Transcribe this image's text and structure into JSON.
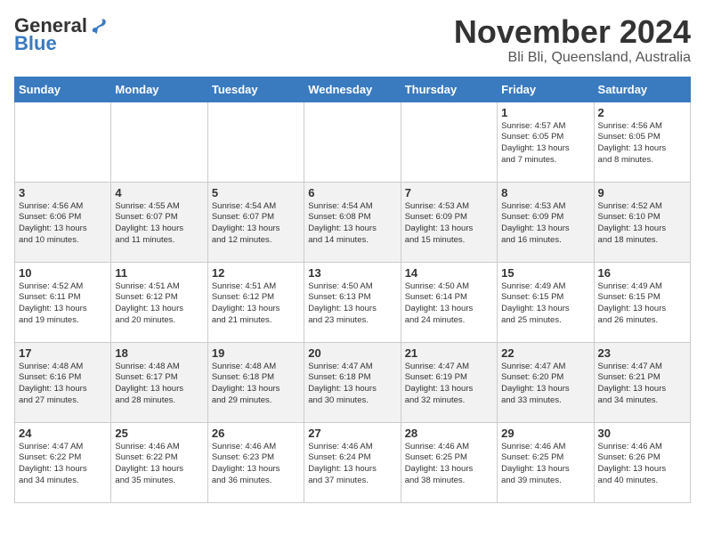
{
  "header": {
    "logo_general": "General",
    "logo_blue": "Blue",
    "month_title": "November 2024",
    "location": "Bli Bli, Queensland, Australia"
  },
  "days_of_week": [
    "Sunday",
    "Monday",
    "Tuesday",
    "Wednesday",
    "Thursday",
    "Friday",
    "Saturday"
  ],
  "weeks": [
    [
      {
        "day": "",
        "info": ""
      },
      {
        "day": "",
        "info": ""
      },
      {
        "day": "",
        "info": ""
      },
      {
        "day": "",
        "info": ""
      },
      {
        "day": "",
        "info": ""
      },
      {
        "day": "1",
        "info": "Sunrise: 4:57 AM\nSunset: 6:05 PM\nDaylight: 13 hours\nand 7 minutes."
      },
      {
        "day": "2",
        "info": "Sunrise: 4:56 AM\nSunset: 6:05 PM\nDaylight: 13 hours\nand 8 minutes."
      }
    ],
    [
      {
        "day": "3",
        "info": "Sunrise: 4:56 AM\nSunset: 6:06 PM\nDaylight: 13 hours\nand 10 minutes."
      },
      {
        "day": "4",
        "info": "Sunrise: 4:55 AM\nSunset: 6:07 PM\nDaylight: 13 hours\nand 11 minutes."
      },
      {
        "day": "5",
        "info": "Sunrise: 4:54 AM\nSunset: 6:07 PM\nDaylight: 13 hours\nand 12 minutes."
      },
      {
        "day": "6",
        "info": "Sunrise: 4:54 AM\nSunset: 6:08 PM\nDaylight: 13 hours\nand 14 minutes."
      },
      {
        "day": "7",
        "info": "Sunrise: 4:53 AM\nSunset: 6:09 PM\nDaylight: 13 hours\nand 15 minutes."
      },
      {
        "day": "8",
        "info": "Sunrise: 4:53 AM\nSunset: 6:09 PM\nDaylight: 13 hours\nand 16 minutes."
      },
      {
        "day": "9",
        "info": "Sunrise: 4:52 AM\nSunset: 6:10 PM\nDaylight: 13 hours\nand 18 minutes."
      }
    ],
    [
      {
        "day": "10",
        "info": "Sunrise: 4:52 AM\nSunset: 6:11 PM\nDaylight: 13 hours\nand 19 minutes."
      },
      {
        "day": "11",
        "info": "Sunrise: 4:51 AM\nSunset: 6:12 PM\nDaylight: 13 hours\nand 20 minutes."
      },
      {
        "day": "12",
        "info": "Sunrise: 4:51 AM\nSunset: 6:12 PM\nDaylight: 13 hours\nand 21 minutes."
      },
      {
        "day": "13",
        "info": "Sunrise: 4:50 AM\nSunset: 6:13 PM\nDaylight: 13 hours\nand 23 minutes."
      },
      {
        "day": "14",
        "info": "Sunrise: 4:50 AM\nSunset: 6:14 PM\nDaylight: 13 hours\nand 24 minutes."
      },
      {
        "day": "15",
        "info": "Sunrise: 4:49 AM\nSunset: 6:15 PM\nDaylight: 13 hours\nand 25 minutes."
      },
      {
        "day": "16",
        "info": "Sunrise: 4:49 AM\nSunset: 6:15 PM\nDaylight: 13 hours\nand 26 minutes."
      }
    ],
    [
      {
        "day": "17",
        "info": "Sunrise: 4:48 AM\nSunset: 6:16 PM\nDaylight: 13 hours\nand 27 minutes."
      },
      {
        "day": "18",
        "info": "Sunrise: 4:48 AM\nSunset: 6:17 PM\nDaylight: 13 hours\nand 28 minutes."
      },
      {
        "day": "19",
        "info": "Sunrise: 4:48 AM\nSunset: 6:18 PM\nDaylight: 13 hours\nand 29 minutes."
      },
      {
        "day": "20",
        "info": "Sunrise: 4:47 AM\nSunset: 6:18 PM\nDaylight: 13 hours\nand 30 minutes."
      },
      {
        "day": "21",
        "info": "Sunrise: 4:47 AM\nSunset: 6:19 PM\nDaylight: 13 hours\nand 32 minutes."
      },
      {
        "day": "22",
        "info": "Sunrise: 4:47 AM\nSunset: 6:20 PM\nDaylight: 13 hours\nand 33 minutes."
      },
      {
        "day": "23",
        "info": "Sunrise: 4:47 AM\nSunset: 6:21 PM\nDaylight: 13 hours\nand 34 minutes."
      }
    ],
    [
      {
        "day": "24",
        "info": "Sunrise: 4:47 AM\nSunset: 6:22 PM\nDaylight: 13 hours\nand 34 minutes."
      },
      {
        "day": "25",
        "info": "Sunrise: 4:46 AM\nSunset: 6:22 PM\nDaylight: 13 hours\nand 35 minutes."
      },
      {
        "day": "26",
        "info": "Sunrise: 4:46 AM\nSunset: 6:23 PM\nDaylight: 13 hours\nand 36 minutes."
      },
      {
        "day": "27",
        "info": "Sunrise: 4:46 AM\nSunset: 6:24 PM\nDaylight: 13 hours\nand 37 minutes."
      },
      {
        "day": "28",
        "info": "Sunrise: 4:46 AM\nSunset: 6:25 PM\nDaylight: 13 hours\nand 38 minutes."
      },
      {
        "day": "29",
        "info": "Sunrise: 4:46 AM\nSunset: 6:25 PM\nDaylight: 13 hours\nand 39 minutes."
      },
      {
        "day": "30",
        "info": "Sunrise: 4:46 AM\nSunset: 6:26 PM\nDaylight: 13 hours\nand 40 minutes."
      }
    ]
  ]
}
